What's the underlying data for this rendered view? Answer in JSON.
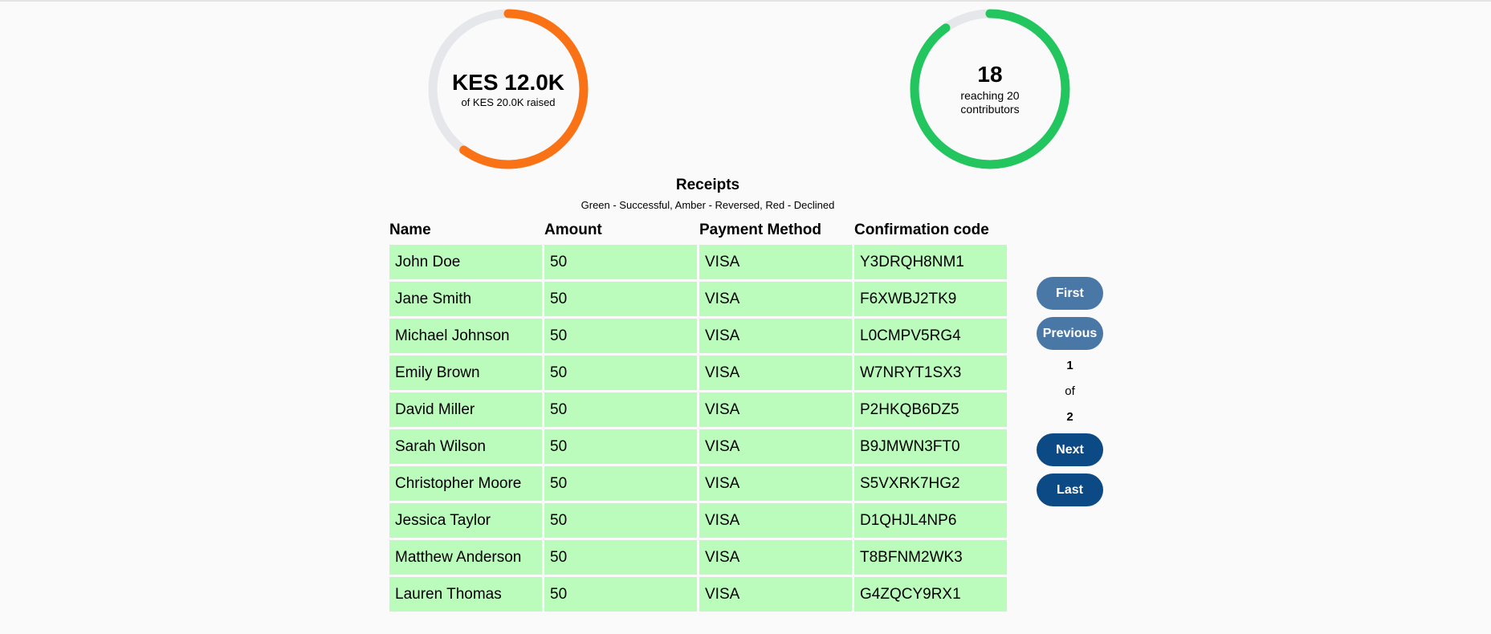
{
  "gauges": {
    "amount": {
      "main": "KES 12.0K",
      "sub": "of KES 20.0K raised",
      "progress": 0.6,
      "color": "#f97316",
      "track_color": "#e5e7eb"
    },
    "contributors": {
      "main": "18",
      "sub": "reaching 20 contributors",
      "progress": 0.9,
      "color": "#22c55e",
      "track_color": "#e5e7eb"
    }
  },
  "receipts": {
    "title": "Receipts",
    "legend": "Green - Successful, Amber - Reversed, Red - Declined",
    "success_color": "#bbfbbb",
    "columns": [
      "Name",
      "Amount",
      "Payment Method",
      "Confirmation code"
    ],
    "rows": [
      [
        "John Doe",
        "50",
        "VISA",
        "Y3DRQH8NM1"
      ],
      [
        "Jane Smith",
        "50",
        "VISA",
        "F6XWBJ2TK9"
      ],
      [
        "Michael Johnson",
        "50",
        "VISA",
        "L0CMPV5RG4"
      ],
      [
        "Emily Brown",
        "50",
        "VISA",
        "W7NRYT1SX3"
      ],
      [
        "David Miller",
        "50",
        "VISA",
        "P2HKQB6DZ5"
      ],
      [
        "Sarah Wilson",
        "50",
        "VISA",
        "B9JMWN3FT0"
      ],
      [
        "Christopher Moore",
        "50",
        "VISA",
        "S5VXRK7HG2"
      ],
      [
        "Jessica Taylor",
        "50",
        "VISA",
        "D1QHJL4NP6"
      ],
      [
        "Matthew Anderson",
        "50",
        "VISA",
        "T8BFNM2WK3"
      ],
      [
        "Lauren Thomas",
        "50",
        "VISA",
        "G4ZQCY9RX1"
      ]
    ]
  },
  "pagination": {
    "first_label": "First",
    "previous_label": "Previous",
    "current_page": "1",
    "of_label": "of",
    "total_pages": "2",
    "next_label": "Next",
    "last_label": "Last"
  }
}
